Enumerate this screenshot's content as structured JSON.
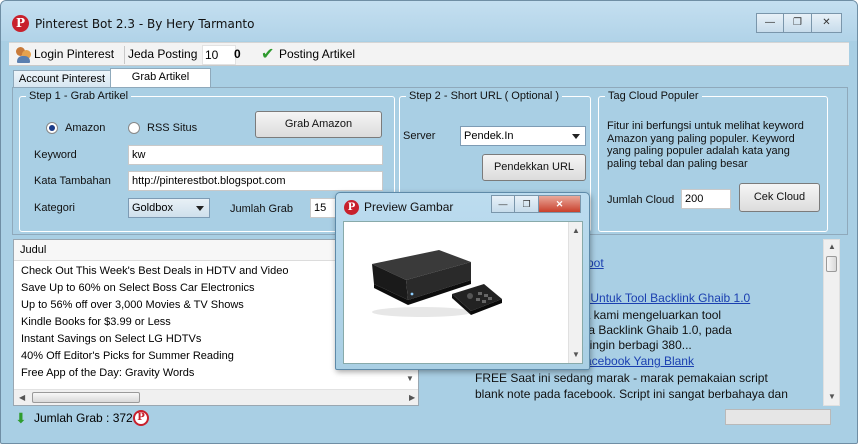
{
  "window": {
    "title": "Pinterest Bot 2.3 - By Hery Tarmanto",
    "icon": "pinterest-icon",
    "controls": [
      "minimize",
      "restore",
      "close"
    ]
  },
  "toolbar": {
    "login_label": "Login Pinterest",
    "jeda_label": "Jeda Posting",
    "jeda_value": "10",
    "count_value": "0",
    "posting_label": "Posting Artikel"
  },
  "tabs": [
    {
      "label": "Account Pinterest",
      "active": false
    },
    {
      "label": "Grab Artikel",
      "active": true
    }
  ],
  "step1": {
    "title": "Step 1 - Grab Artikel",
    "radio_amazon": "Amazon",
    "radio_rss": "RSS Situs",
    "selected_source": "Amazon",
    "grab_button": "Grab Amazon",
    "keyword_label": "Keyword",
    "keyword_value": "kw",
    "kata_label": "Kata Tambahan",
    "kata_value": "http://pinterestbot.blogspot.com",
    "kategori_label": "Kategori",
    "kategori_value": "Goldbox",
    "jumlah_label": "Jumlah Grab",
    "jumlah_value": "15"
  },
  "step2": {
    "title": "Step 2 - Short URL ( Optional )",
    "server_label": "Server",
    "server_value": "Pendek.In",
    "shorten_button": "Pendekkan URL"
  },
  "tagcloud": {
    "title": "Tag Cloud Populer",
    "description_lines": [
      "Fitur ini berfungsi untuk melihat keyword",
      "Amazon yang paling populer. Keyword",
      "yang paling populer adalah kata yang",
      "paling tebal dan paling besar"
    ],
    "jumlah_label": "Jumlah Cloud",
    "jumlah_value": "200",
    "cek_button": "Cek Cloud"
  },
  "list": {
    "header": "Judul",
    "rows": [
      "Check Out This Week's Best Deals in HDTV and Video",
      "Save Up to 60% on Select Boss Car Electronics",
      "Up to 56% off over 3,000 Movies & TV Shows",
      "Kindle Books for $3.99 or Less",
      "Instant Savings on Select LG HDTVs",
      "40% Off Editor's Picks for Summer Reading",
      "Free App of the Day: Gravity Words"
    ]
  },
  "browser": {
    "link1": "pot",
    "link2": "oved Untuk Tool Backlink Ghaib 1.0",
    "text1": "mnya kami mengeluarkan tool",
    "text2": "rnama Backlink Ghaib 1.0, pada",
    "text3": "kami ingin berbagi 380...",
    "link3": "up Facebook Yang Blank",
    "text4": "FREE Saat ini sedang marak - marak pemakaian script",
    "text5": "blank note pada facebook. Script ini sangat berbahaya dan"
  },
  "status": {
    "label": "Jumlah Grab : 372"
  },
  "preview": {
    "title": "Preview Gambar",
    "image": "media-player-device-image"
  }
}
